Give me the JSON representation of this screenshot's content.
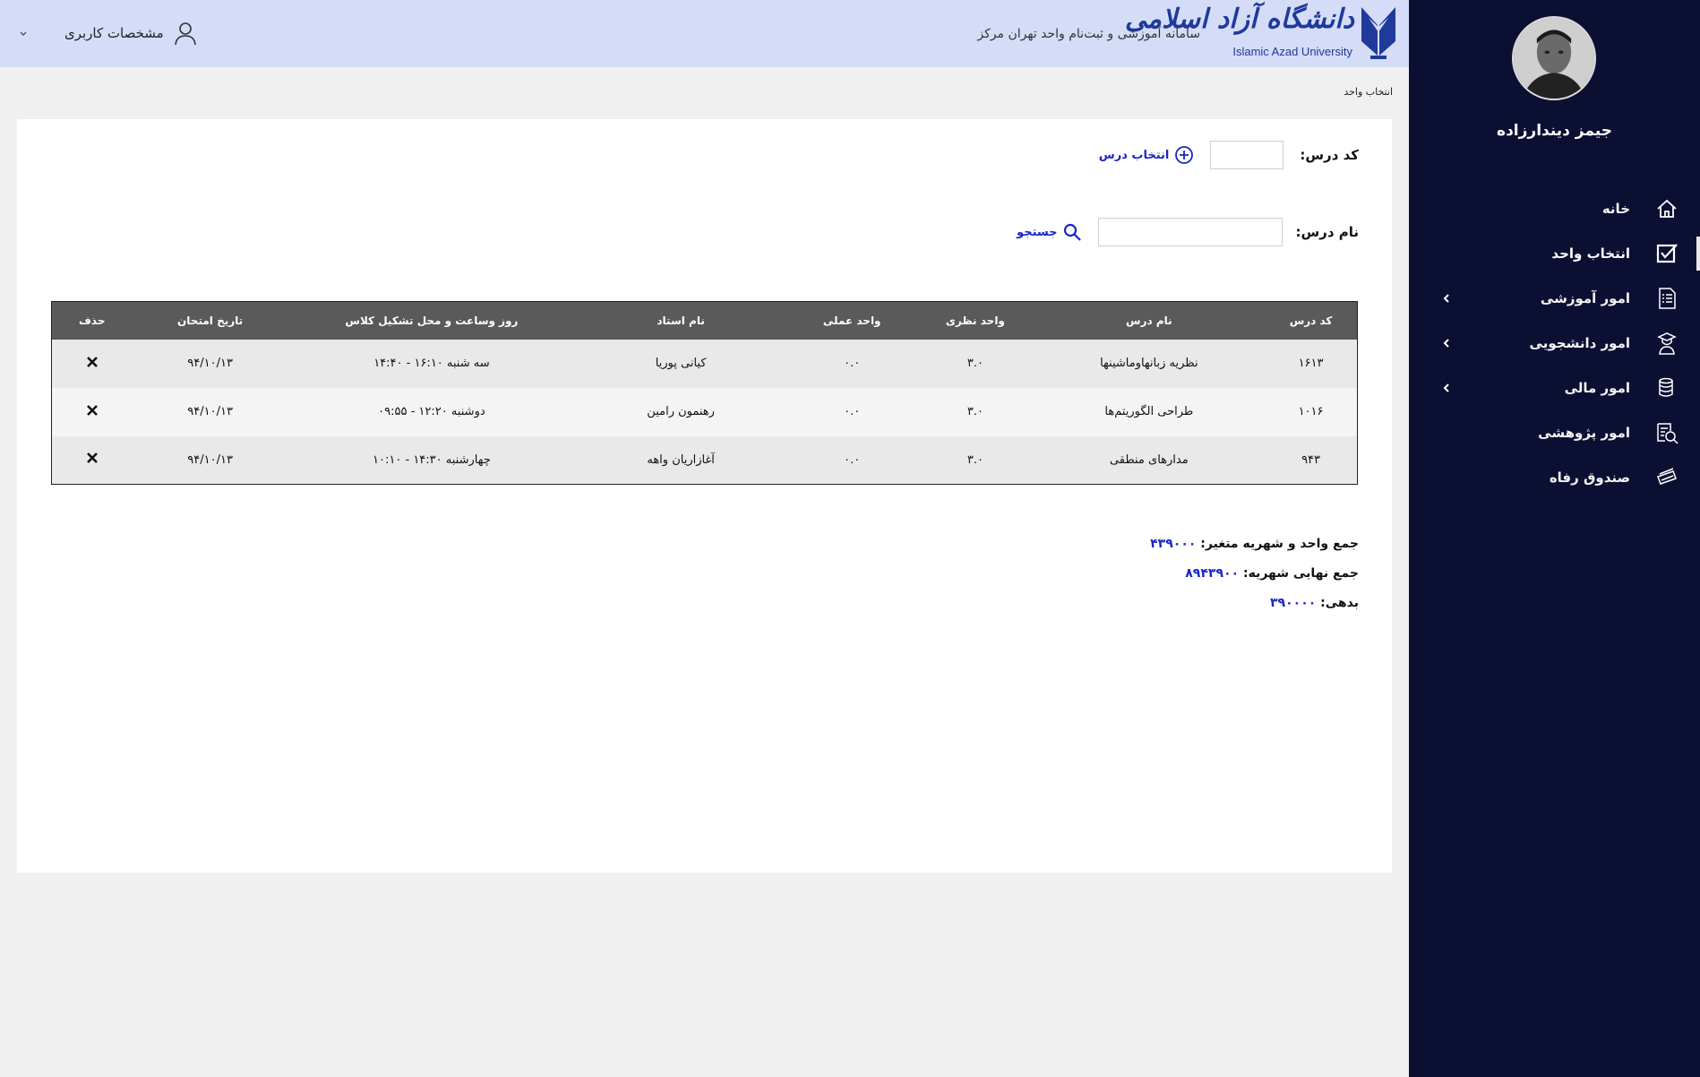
{
  "header": {
    "logo_fa": "دانشگاه آزاد اسلامی",
    "logo_en": "Islamic Azad University",
    "system_title": "سامانه آموزشی و ثبت‌نام واحد تهران مرکز",
    "user_menu_label": "مشخصات کاربری"
  },
  "sidebar": {
    "user_name": "جیمز دیندارزاده",
    "items": [
      {
        "label": "خانه",
        "icon": "home-icon"
      },
      {
        "label": "انتخاب واحد",
        "icon": "checkbox-icon",
        "active": true
      },
      {
        "label": "امور آموزشی",
        "icon": "document-list-icon",
        "has_submenu": true
      },
      {
        "label": "امور دانشجویی",
        "icon": "graduate-icon",
        "has_submenu": true
      },
      {
        "label": "امور مالی",
        "icon": "coins-icon",
        "has_submenu": true
      },
      {
        "label": "امور پژوهشی",
        "icon": "research-icon"
      },
      {
        "label": "صندوق رفاه",
        "icon": "cards-icon"
      }
    ]
  },
  "breadcrumb": "انتخاب واحد",
  "form": {
    "course_code_label": "کد درس:",
    "course_code_value": "",
    "select_course_label": "انتخاب درس",
    "course_name_label": "نام درس:",
    "course_name_value": "",
    "search_label": "جستجو"
  },
  "table": {
    "headers": [
      "کد درس",
      "نام درس",
      "واحد نظری",
      "واحد عملی",
      "نام استاد",
      "روز وساعت و محل تشکیل کلاس",
      "تاریخ امتحان",
      "حذف"
    ],
    "rows": [
      {
        "code": "۱۶۱۳",
        "name": "نظریه زبانهاوماشینها",
        "theory": "۳.۰",
        "practical": "۰.۰",
        "teacher": "کیانی پوریا",
        "schedule": "سه شنبه ۱۶:۱۰ - ۱۴:۴۰",
        "exam": "۹۴/۱۰/۱۳"
      },
      {
        "code": "۱۰۱۶",
        "name": "طراحی الگوریتم‌ها",
        "theory": "۳.۰",
        "practical": "۰.۰",
        "teacher": "رهنمون رامین",
        "schedule": "دوشنبه ۱۲:۲۰ - ۰۹:۵۵",
        "exam": "۹۴/۱۰/۱۳"
      },
      {
        "code": "۹۴۳",
        "name": "مدارهای منطقی",
        "theory": "۳.۰",
        "practical": "۰.۰",
        "teacher": "آغازاریان واهه",
        "schedule": "چهارشنبه ۱۴:۳۰ - ۱۰:۱۰",
        "exam": "۹۴/۱۰/۱۳"
      }
    ]
  },
  "summary": {
    "variable_label": "جمع واحد و شهریه متغیر:",
    "variable_value": "۴۳۹۰۰۰",
    "final_label": "جمع نهایی شهریه:",
    "final_value": "۸۹۴۳۹۰۰",
    "debt_label": "بدهی:",
    "debt_value": "۳۹۰۰۰۰"
  },
  "colors": {
    "sidebar_bg": "#0b1033",
    "header_bg": "#d5dcf8",
    "link_blue": "#1a25c8",
    "table_header_bg": "#5a5a5a"
  }
}
